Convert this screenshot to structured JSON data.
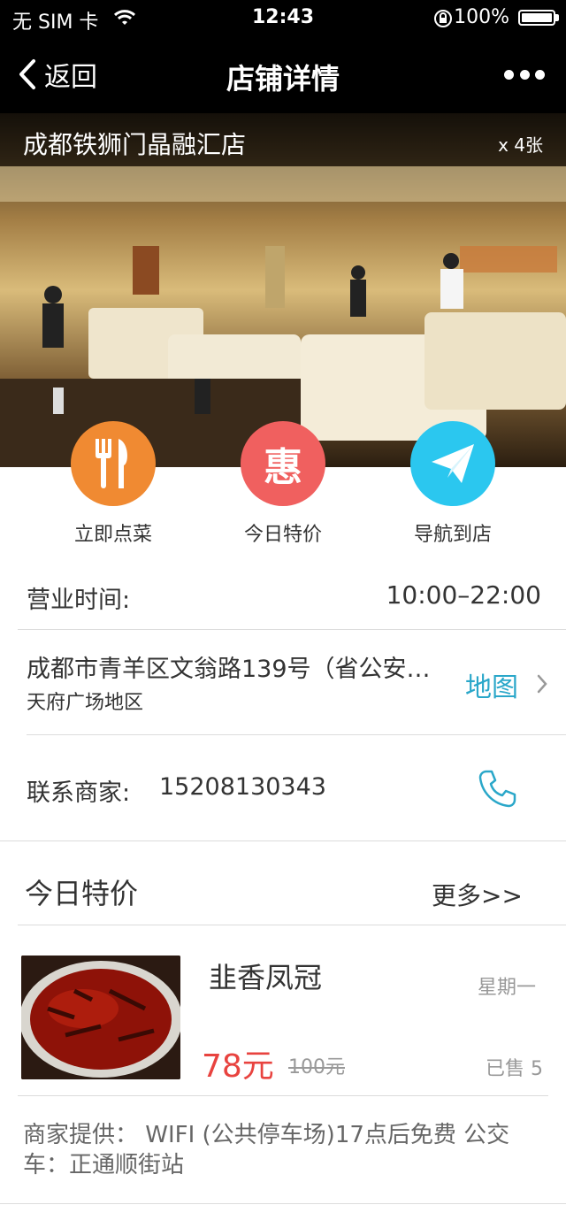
{
  "status_bar": {
    "carrier": "无 SIM 卡",
    "time": "12:43",
    "battery": "100%"
  },
  "nav": {
    "back_label": "返回",
    "title": "店铺详情"
  },
  "hero": {
    "store_name": "成都铁狮门晶融汇店",
    "photo_count": "x 4张"
  },
  "actions": [
    {
      "label": "立即点菜",
      "icon": "fork-knife-icon",
      "color": "#f08a32"
    },
    {
      "label": "今日特价",
      "icon": "hui-badge-icon",
      "icon_text": "惠",
      "color": "#f0605f"
    },
    {
      "label": "导航到店",
      "icon": "paper-plane-icon",
      "color": "#2bc7ef"
    }
  ],
  "hours": {
    "label": "营业时间:",
    "value": "10:00–22:00"
  },
  "address": {
    "line1": "成都市青羊区文翁路139号（省公安…",
    "line2": "天府广场地区",
    "map_label": "地图"
  },
  "contact": {
    "label": "联系商家:",
    "phone": "15208130343"
  },
  "specials": {
    "title": "今日特价",
    "more_label": "更多>>",
    "items": [
      {
        "name": "韭香凤冠",
        "day": "星期一",
        "price": "78元",
        "original_price": "100元",
        "sold": "已售 5"
      }
    ]
  },
  "facilities": {
    "text": "商家提供：   WIFI  (公共停车场)17点后免费  公交车：正通顺街站"
  },
  "colors": {
    "accent_teal": "#2aa7c9",
    "price_red": "#e8433f"
  }
}
